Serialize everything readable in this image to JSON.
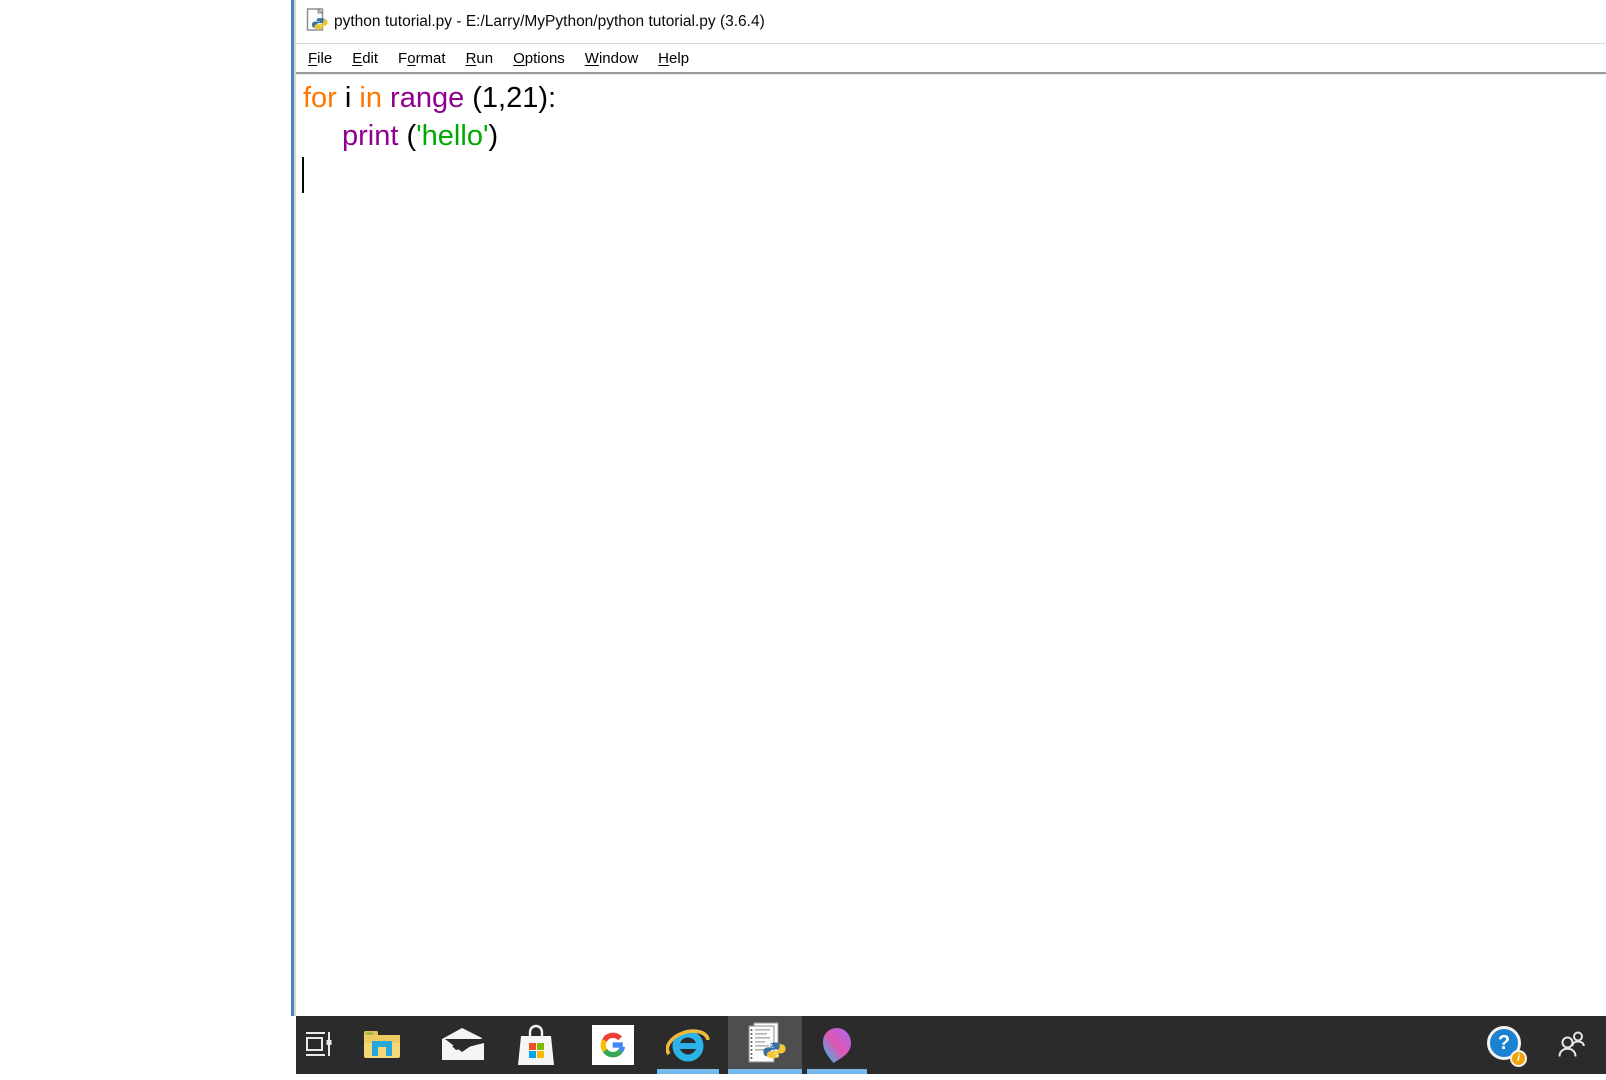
{
  "window": {
    "title": "python tutorial.py - E:/Larry/MyPython/python tutorial.py (3.6.4)",
    "app": "IDLE editor window",
    "icon": "python-file-icon"
  },
  "menu": {
    "items": [
      {
        "label": "File",
        "pre": "",
        "u": "F",
        "post": "ile"
      },
      {
        "label": "Edit",
        "pre": "",
        "u": "E",
        "post": "dit"
      },
      {
        "label": "Format",
        "pre": "F",
        "u": "o",
        "post": "rmat"
      },
      {
        "label": "Run",
        "pre": "",
        "u": "R",
        "post": "un"
      },
      {
        "label": "Options",
        "pre": "",
        "u": "O",
        "post": "ptions"
      },
      {
        "label": "Window",
        "pre": "",
        "u": "W",
        "post": "indow"
      },
      {
        "label": "Help",
        "pre": "",
        "u": "H",
        "post": "elp"
      }
    ]
  },
  "editor": {
    "cursor_visible": true,
    "lines": [
      {
        "tokens": [
          {
            "text": "for",
            "color": "#ff7700"
          },
          {
            "text": " i ",
            "color": "#000000"
          },
          {
            "text": "in",
            "color": "#ff7700"
          },
          {
            "text": " ",
            "color": "#000000"
          },
          {
            "text": "range",
            "color": "#900090"
          },
          {
            "text": " (1,21):",
            "color": "#000000"
          }
        ]
      },
      {
        "tokens": [
          {
            "text": "print",
            "color": "#900090"
          },
          {
            "text": " (",
            "color": "#000000"
          },
          {
            "text": "'hello'",
            "color": "#00aa00"
          },
          {
            "text": ")",
            "color": "#000000"
          }
        ]
      }
    ]
  },
  "taskbar": {
    "items": [
      {
        "name": "task-view",
        "state": "idle"
      },
      {
        "name": "file-explorer",
        "state": "idle"
      },
      {
        "name": "mail",
        "state": "idle"
      },
      {
        "name": "microsoft-store",
        "state": "idle"
      },
      {
        "name": "google",
        "state": "idle"
      },
      {
        "name": "internet-explorer",
        "state": "running"
      },
      {
        "name": "python-idle",
        "state": "active"
      },
      {
        "name": "paint-3d",
        "state": "running"
      },
      {
        "name": "get-help",
        "state": "idle"
      },
      {
        "name": "people",
        "state": "idle"
      }
    ]
  },
  "colors": {
    "window_border": "#4b82c4",
    "taskbar_bg": "#2b2b2b",
    "taskbar_active": "#4e4e4e",
    "underline": "#76b9ed",
    "keyword": "#ff7700",
    "builtin": "#900090",
    "string": "#00aa00"
  }
}
